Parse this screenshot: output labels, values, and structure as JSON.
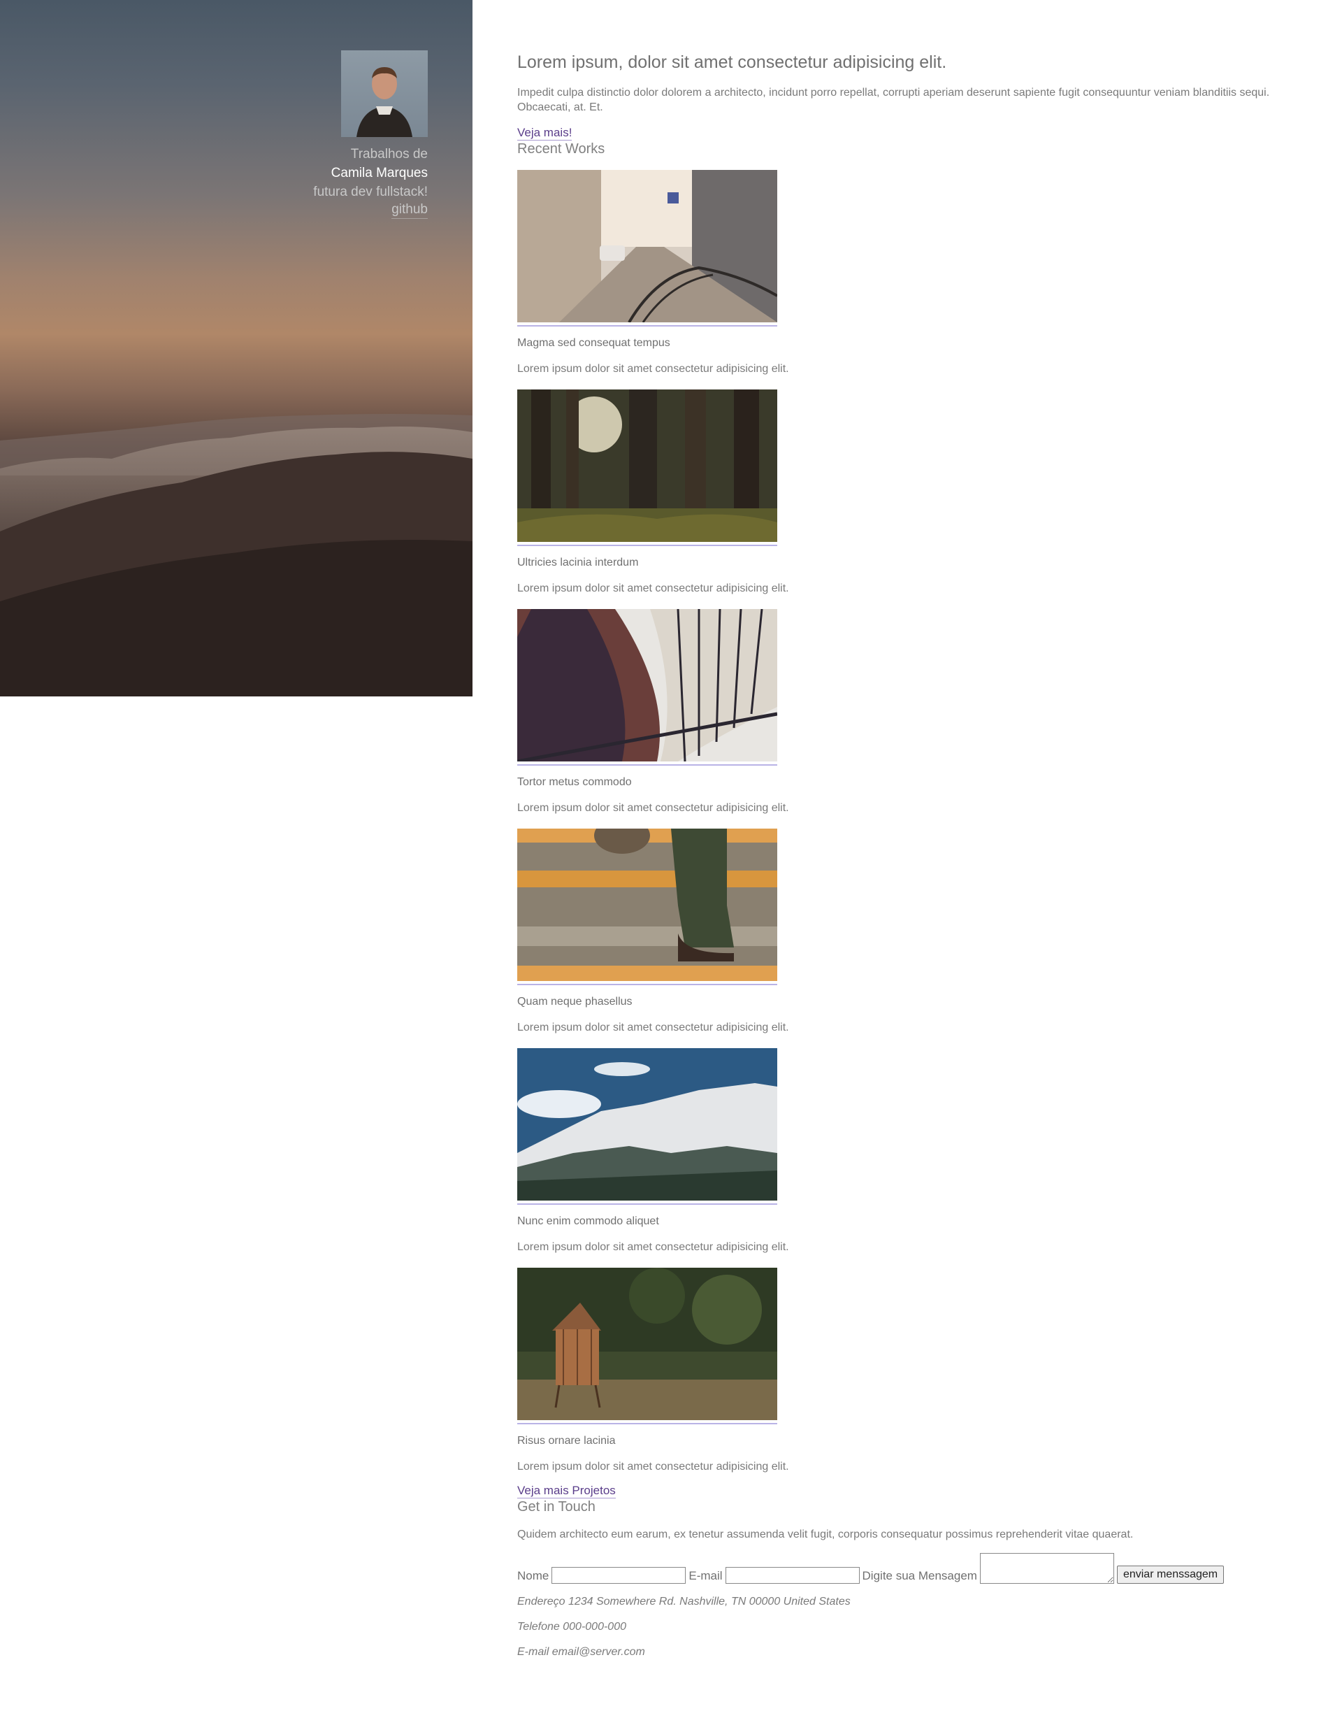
{
  "sidebar": {
    "lead": "Trabalhos de",
    "name": "Camila Marques",
    "tagline": "futura dev fullstack!",
    "github_label": "github"
  },
  "intro": {
    "heading": "Lorem ipsum, dolor sit amet consectetur adipisicing elit.",
    "text": "Impedit culpa distinctio dolor dolorem a architecto, incidunt porro repellat, corrupti aperiam deserunt sapiente fugit consequuntur veniam blanditiis sequi. Obcaecati, at. Et.",
    "more_link": "Veja mais!"
  },
  "recent_works": {
    "title": "Recent Works",
    "items": [
      {
        "title": "Magma sed consequat tempus",
        "text": "Lorem ipsum dolor sit amet consectetur adipisicing elit."
      },
      {
        "title": "Ultricies lacinia interdum",
        "text": "Lorem ipsum dolor sit amet consectetur adipisicing elit."
      },
      {
        "title": "Tortor metus commodo",
        "text": "Lorem ipsum dolor sit amet consectetur adipisicing elit."
      },
      {
        "title": "Quam neque phasellus",
        "text": "Lorem ipsum dolor sit amet consectetur adipisicing elit."
      },
      {
        "title": "Nunc enim commodo aliquet",
        "text": "Lorem ipsum dolor sit amet consectetur adipisicing elit."
      },
      {
        "title": "Risus ornare lacinia",
        "text": "Lorem ipsum dolor sit amet consectetur adipisicing elit."
      }
    ],
    "more_link": "Veja mais Projetos"
  },
  "contact": {
    "title": "Get in Touch",
    "text": "Quidem architecto eum earum, ex tenetur assumenda velit fugit, corporis consequatur possimus reprehenderit vitae quaerat.",
    "name_label": "Nome",
    "name_value": "",
    "email_label": "E-mail",
    "email_value": "",
    "message_label": "Digite sua Mensagem",
    "message_value": "",
    "send_label": "enviar menssagem",
    "address": "Endereço 1234 Somewhere Rd. Nashville, TN 00000 United States",
    "phone": "Telefone 000-000-000",
    "email_info": "E-mail email@server.com"
  },
  "colors": {
    "link": "#5a3d8a",
    "text": "#777777",
    "thumb_border": "#b9b3e6"
  }
}
